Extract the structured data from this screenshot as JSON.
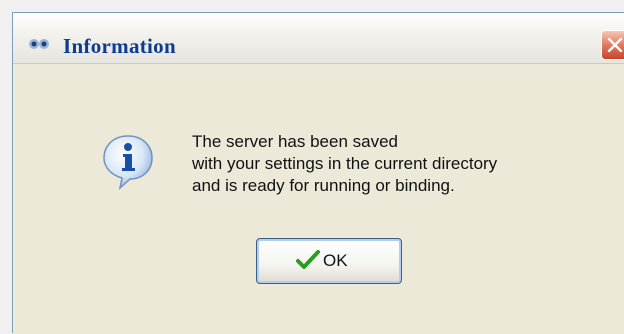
{
  "window": {
    "title": "Information",
    "title_icon": "app-logo-icon",
    "close_icon": "close-icon"
  },
  "message": {
    "icon": "info-icon",
    "lines": [
      "The server has been saved",
      "with your settings in the current directory",
      "and is ready for running or binding."
    ]
  },
  "buttons": {
    "ok_label": "OK",
    "ok_icon": "checkmark-icon"
  },
  "colors": {
    "title_text": "#0d3b8f",
    "close_button": "#e07a5f",
    "dialog_background": "#ece9d8",
    "check_green": "#2a9d1f"
  }
}
